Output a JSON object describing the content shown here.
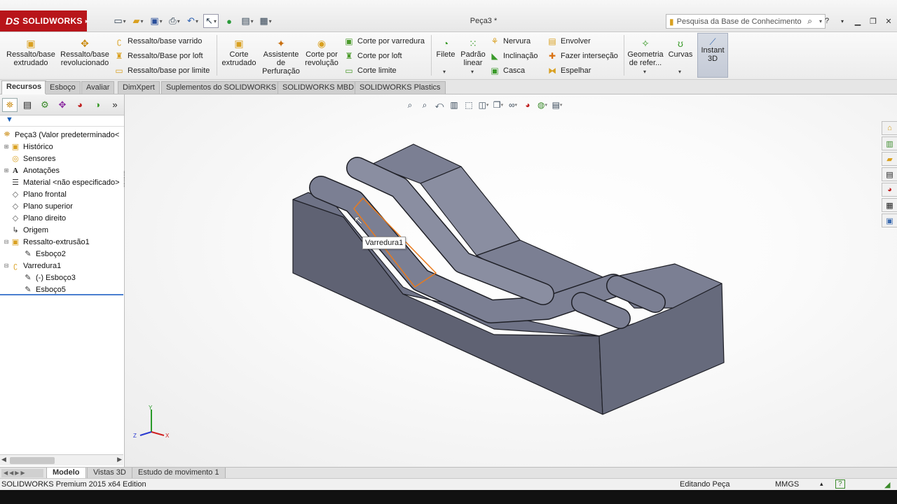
{
  "app": {
    "brand": "SOLIDWORKS",
    "brand_prefix": "DS",
    "doc_title": "Peça3 *"
  },
  "search": {
    "placeholder": "Pesquisa da Base de Conhecimento"
  },
  "ribbon": {
    "big": [
      {
        "label": "Ressalto/base extrudado",
        "icon": "extruded-boss-icon"
      },
      {
        "label": "Ressalto/base revolucionado",
        "icon": "revolved-boss-icon"
      },
      {
        "label": "Corte extrudado",
        "icon": "extruded-cut-icon"
      },
      {
        "label": "Assistente de Perfuração",
        "icon": "hole-wizard-icon"
      },
      {
        "label": "Corte por revolução",
        "icon": "revolved-cut-icon"
      },
      {
        "label": "Filete",
        "icon": "fillet-icon"
      },
      {
        "label": "Padrão linear",
        "icon": "linear-pattern-icon"
      },
      {
        "label": "Geometria de refer...",
        "icon": "reference-geometry-icon"
      },
      {
        "label": "Curvas",
        "icon": "curves-icon"
      },
      {
        "label": "Instant 3D",
        "icon": "instant3d-icon"
      }
    ],
    "small": [
      {
        "label": "Ressalto/base varrido",
        "icon": "swept-boss-icon"
      },
      {
        "label": "Ressalto/Base por loft",
        "icon": "lofted-boss-icon"
      },
      {
        "label": "Ressalto/base por limite",
        "icon": "boundary-boss-icon"
      },
      {
        "label": "Corte por varredura",
        "icon": "swept-cut-icon"
      },
      {
        "label": "Corte por loft",
        "icon": "lofted-cut-icon"
      },
      {
        "label": "Corte limite",
        "icon": "boundary-cut-icon"
      },
      {
        "label": "Nervura",
        "icon": "rib-icon"
      },
      {
        "label": "Inclinação",
        "icon": "draft-icon"
      },
      {
        "label": "Casca",
        "icon": "shell-icon"
      },
      {
        "label": "Envolver",
        "icon": "wrap-icon"
      },
      {
        "label": "Fazer interseção",
        "icon": "intersect-icon"
      },
      {
        "label": "Espelhar",
        "icon": "mirror-icon"
      }
    ]
  },
  "tabs": [
    "Recursos",
    "Esboço",
    "Avaliar",
    "DimXpert",
    "Suplementos do SOLIDWORKS",
    "SOLIDWORKS MBD",
    "SOLIDWORKS Plastics"
  ],
  "tree": [
    {
      "label": "Peça3  (Valor predeterminado<",
      "icon": "part-icon",
      "exp": "",
      "indent": 0
    },
    {
      "label": "Histórico",
      "icon": "history-folder-icon",
      "exp": "+",
      "indent": 1
    },
    {
      "label": "Sensores",
      "icon": "sensors-icon",
      "exp": "",
      "indent": 1
    },
    {
      "label": "Anotações",
      "icon": "annotations-icon",
      "exp": "+",
      "indent": 1
    },
    {
      "label": "Material <não especificado>",
      "icon": "material-icon",
      "exp": "",
      "indent": 1
    },
    {
      "label": "Plano frontal",
      "icon": "plane-icon",
      "exp": "",
      "indent": 1
    },
    {
      "label": "Plano superior",
      "icon": "plane-icon",
      "exp": "",
      "indent": 1
    },
    {
      "label": "Plano direito",
      "icon": "plane-icon",
      "exp": "",
      "indent": 1
    },
    {
      "label": "Origem",
      "icon": "origin-icon",
      "exp": "",
      "indent": 1
    },
    {
      "label": "Ressalto-extrusão1",
      "icon": "extrude-feature-icon",
      "exp": "−",
      "indent": 1
    },
    {
      "label": "Esboço2",
      "icon": "sketch-icon",
      "exp": "",
      "indent": 2
    },
    {
      "label": "Varredura1",
      "icon": "sweep-feature-icon",
      "exp": "−",
      "indent": 1
    },
    {
      "label": "(-) Esboço3",
      "icon": "sketch-icon",
      "exp": "",
      "indent": 2
    },
    {
      "label": "Esboço5",
      "icon": "sketch-icon",
      "exp": "",
      "indent": 2
    }
  ],
  "viewport": {
    "tooltip": "Varredura1",
    "triad": {
      "x": "X",
      "y": "Y",
      "z": "Z"
    },
    "colors": {
      "body": "#5f6273",
      "top": "#7b7f93",
      "edge": "#1e1f26",
      "highlight": "#e87a1e"
    }
  },
  "bottom_tabs": [
    "Modelo",
    "Vistas 3D",
    "Estudo de movimento 1"
  ],
  "status": {
    "edition": "SOLIDWORKS Premium 2015 x64 Edition",
    "mode": "Editando Peça",
    "units": "MMGS"
  }
}
